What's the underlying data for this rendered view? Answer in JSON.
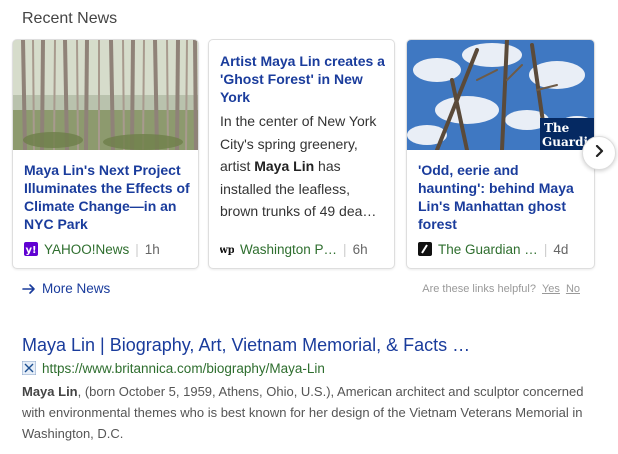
{
  "recent_news": {
    "title": "Recent News",
    "cards": [
      {
        "headline": "Maya Lin's Next Project Illuminates the Effects of Climate Change—in an NYC Park",
        "source": "YAHOO!News",
        "source_icon": "yahoo-logo-icon",
        "time": "1h"
      },
      {
        "headline": "Artist Maya Lin creates a 'Ghost Forest' in New York",
        "snippet_before": "In the center of New York City's spring greenery, artist ",
        "snippet_bold": "Maya Lin",
        "snippet_after": " has installed the leafless, brown trunks of 49 dea…",
        "source": "Washington P…",
        "source_icon": "washington-post-logo-icon",
        "time": "6h"
      },
      {
        "headline": "'Odd, eerie and haunting': behind Maya Lin's Manhattan ghost forest",
        "source": "The Guardian …",
        "source_icon": "guardian-logo-icon",
        "time": "4d",
        "thumb_overlay_line1": "The",
        "thumb_overlay_line2": "Guardia"
      }
    ],
    "more_news": "More News",
    "feedback": {
      "question": "Are these links helpful?",
      "yes": "Yes",
      "no": "No"
    }
  },
  "result": {
    "title": "Maya Lin | Biography, Art, Vietnam Memorial, & Facts …",
    "url": "https://www.britannica.com/biography/Maya-Lin",
    "snippet_bold": "Maya Lin",
    "snippet_rest": ", (born October 5, 1959, Athens, Ohio, U.S.), American architect and sculptor concerned with environmental themes who is best known for her design of the Vietnam Veterans Memorial in Washington, D.C."
  },
  "colors": {
    "link": "#1a3c9c",
    "source_green": "#2e6e2e",
    "yahoo_purple": "#6001d2"
  }
}
